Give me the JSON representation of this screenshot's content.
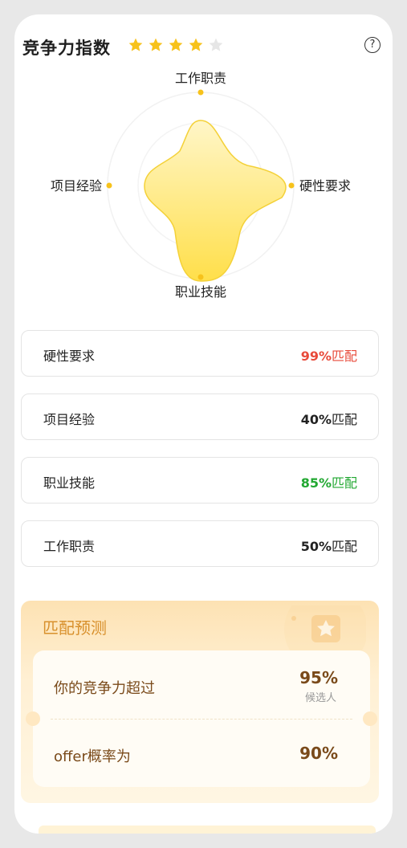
{
  "header": {
    "title": "竞争力指数",
    "stars_filled": 4,
    "stars_total": 5,
    "help_icon": "help-circle-icon",
    "help_glyph": "?"
  },
  "radar": {
    "labels": {
      "top": "工作职责",
      "right": "硬性要求",
      "bottom": "职业技能",
      "left": "项目经验"
    }
  },
  "rows": [
    {
      "label": "硬性要求",
      "value": "99%",
      "suffix": "匹配",
      "color": "#e84a3a"
    },
    {
      "label": "项目经验",
      "value": "40%",
      "suffix": "匹配",
      "color": "#222222"
    },
    {
      "label": "职业技能",
      "value": "85%",
      "suffix": "匹配",
      "color": "#22a832"
    },
    {
      "label": "工作职责",
      "value": "50%",
      "suffix": "匹配",
      "color": "#222222"
    }
  ],
  "predict": {
    "title": "匹配预测",
    "competitive_label": "你的竞争力超过",
    "competitive_value": "95%",
    "competitive_sub": "候选人",
    "offer_label": "offer概率为",
    "offer_value": "90%"
  },
  "colors": {
    "accent": "#f7c21b",
    "star_empty": "#e6e6e6",
    "predict_title": "#d8902c"
  }
}
